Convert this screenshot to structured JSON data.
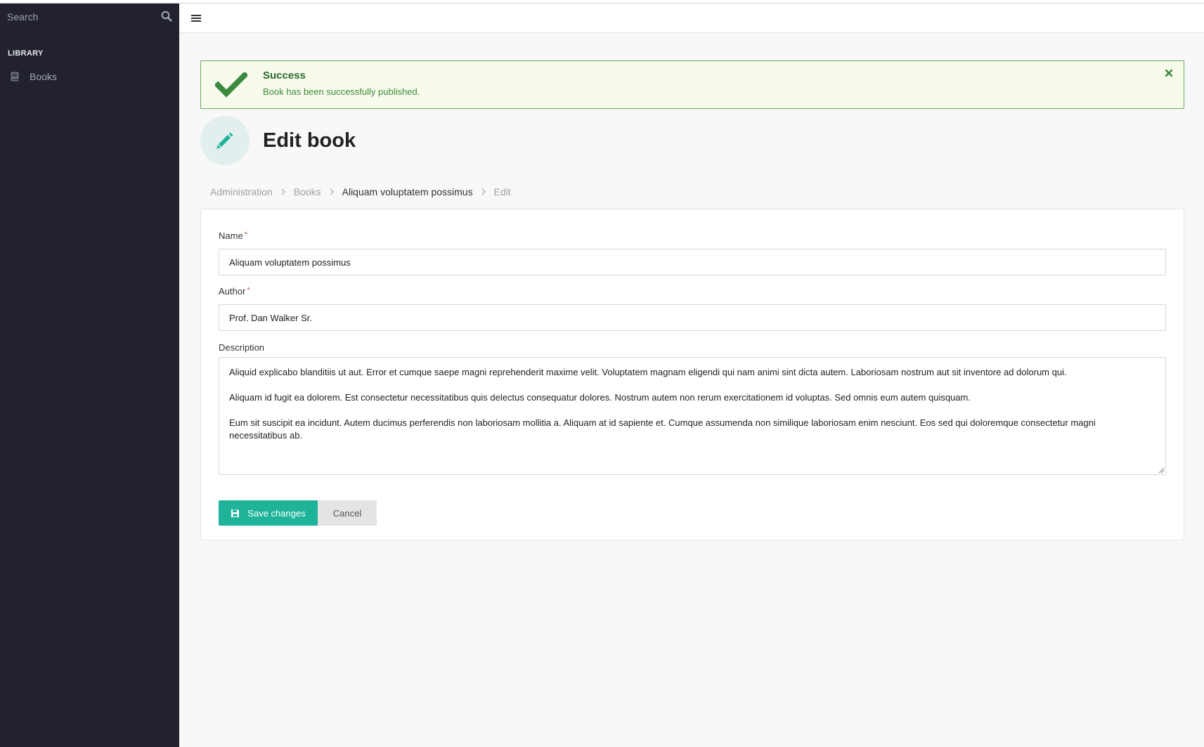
{
  "sidebar": {
    "search": {
      "placeholder": "Search"
    },
    "section_label": "LIBRARY",
    "items": [
      {
        "label": "Books",
        "icon": "book-icon"
      }
    ]
  },
  "alert": {
    "title": "Success",
    "message": "Book has been successfully published.",
    "color": "#6aaa62"
  },
  "page": {
    "title": "Edit book",
    "icon": "pencil-icon",
    "accent": "#1fb49a"
  },
  "breadcrumb": [
    "Administration",
    "Books",
    "Aliquam voluptatem possimus",
    "Edit"
  ],
  "form": {
    "name": {
      "label": "Name",
      "required_mark": "*",
      "value": "Aliquam voluptatem possimus"
    },
    "author": {
      "label": "Author",
      "required_mark": "*",
      "value": "Prof. Dan Walker Sr."
    },
    "description": {
      "label": "Description",
      "paragraphs": [
        "Aliquid explicabo blanditiis ut aut. Error et cumque saepe magni reprehenderit maxime velit. Voluptatem magnam eligendi qui nam animi sint dicta autem. Laboriosam nostrum aut sit inventore ad dolorum qui.",
        "Aliquam id fugit ea dolorem. Est consectetur necessitatibus quis delectus consequatur dolores. Nostrum autem non rerum exercitationem id voluptas. Sed omnis eum autem quisquam.",
        "Eum sit suscipit ea incidunt. Autem ducimus perferendis non laboriosam mollitia a. Aliquam at id sapiente et. Cumque assumenda non similique laboriosam enim nesciunt. Eos sed qui doloremque consectetur magni necessitatibus ab."
      ]
    },
    "save_label": "Save changes",
    "cancel_label": "Cancel"
  }
}
